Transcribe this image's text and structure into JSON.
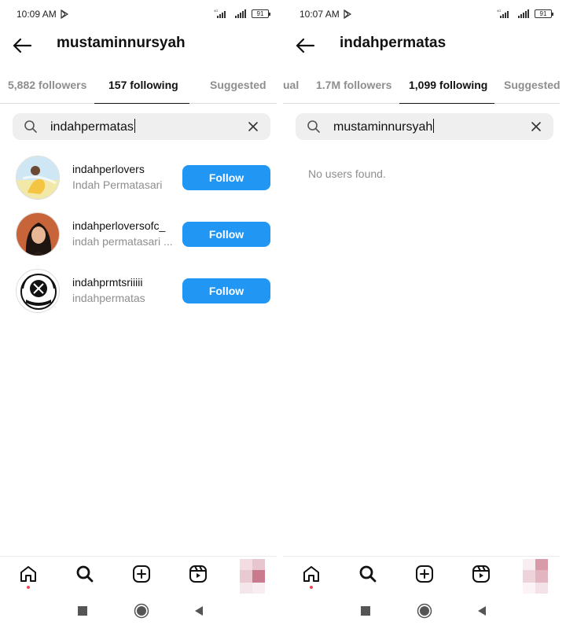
{
  "left": {
    "status": {
      "time": "10:09 AM",
      "battery": "91",
      "network": "4G"
    },
    "header": {
      "title": "mustaminnursyah"
    },
    "tabs": [
      {
        "label": "5,882 followers",
        "active": false
      },
      {
        "label": "157 following",
        "active": true
      },
      {
        "label": "Suggested",
        "active": false
      }
    ],
    "search": {
      "value": "indahpermatas"
    },
    "results": [
      {
        "username": "indahperlovers",
        "fullname": "Indah Permatasari",
        "button": "Follow"
      },
      {
        "username": "indahperloversofc_",
        "fullname": "indah permatasari ...",
        "button": "Follow"
      },
      {
        "username": "indahprmtsriiiii",
        "fullname": "indahpermatas",
        "button": "Follow"
      }
    ]
  },
  "right": {
    "status": {
      "time": "10:07 AM",
      "battery": "91",
      "network": "4G"
    },
    "header": {
      "title": "indahpermatas"
    },
    "tabs": [
      {
        "label": "ual",
        "active": false
      },
      {
        "label": "1.7M followers",
        "active": false
      },
      {
        "label": "1,099 following",
        "active": true
      },
      {
        "label": "Suggested",
        "active": false
      }
    ],
    "search": {
      "value": "mustaminnursyah"
    },
    "empty_message": "No users found."
  },
  "colors": {
    "accent": "#2196f3",
    "muted": "#8e8e8e",
    "notification": "#ed4956"
  },
  "icons": [
    "play-store-icon",
    "signal-icon",
    "battery-icon",
    "back-arrow-icon",
    "search-icon",
    "clear-icon",
    "home-icon",
    "search-nav-icon",
    "create-icon",
    "reels-icon",
    "square-icon",
    "circle-icon",
    "triangle-back-icon"
  ]
}
